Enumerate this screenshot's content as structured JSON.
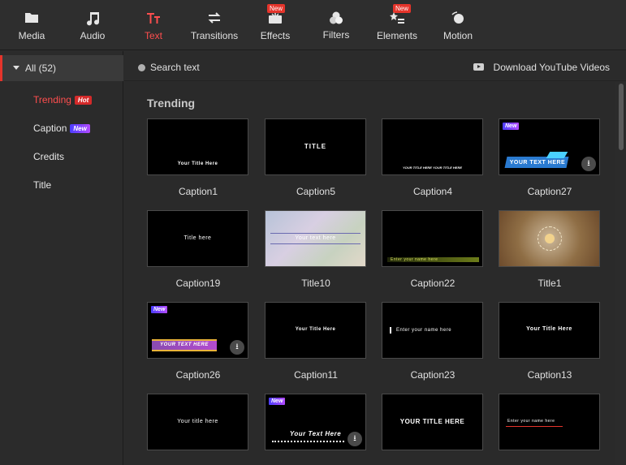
{
  "toolbar": {
    "tabs": [
      {
        "label": "Media",
        "icon": "folder-icon",
        "active": false,
        "new": false
      },
      {
        "label": "Audio",
        "icon": "music-note-icon",
        "active": false,
        "new": false
      },
      {
        "label": "Text",
        "icon": "text-icon",
        "active": true,
        "new": false
      },
      {
        "label": "Transitions",
        "icon": "transitions-icon",
        "active": false,
        "new": false
      },
      {
        "label": "Effects",
        "icon": "effects-icon",
        "active": false,
        "new": true
      },
      {
        "label": "Filters",
        "icon": "filters-icon",
        "active": false,
        "new": false
      },
      {
        "label": "Elements",
        "icon": "elements-icon",
        "active": false,
        "new": true
      },
      {
        "label": "Motion",
        "icon": "motion-icon",
        "active": false,
        "new": false
      }
    ],
    "new_badge": "New",
    "accent": "#ff4e4e"
  },
  "sidebar": {
    "all_label": "All (52)",
    "items": [
      {
        "label": "Trending",
        "tag": "Hot",
        "active": true
      },
      {
        "label": "Caption",
        "tag": "New",
        "active": false
      },
      {
        "label": "Credits",
        "tag": "",
        "active": false
      },
      {
        "label": "Title",
        "tag": "",
        "active": false
      }
    ]
  },
  "search": {
    "placeholder": "Search text",
    "download_label": "Download YouTube Videos"
  },
  "content": {
    "section_title": "Trending",
    "card_new_tag": "New",
    "cards": [
      {
        "name": "Caption1",
        "thumb_text": "Your  Title Here",
        "style": "caption1"
      },
      {
        "name": "Caption5",
        "thumb_text": "TITLE",
        "style": "caption5"
      },
      {
        "name": "Caption4",
        "thumb_text": "YOUR TITLE HERE YOUR TITLE HERE",
        "style": "caption4"
      },
      {
        "name": "Caption27",
        "thumb_text": "YOUR TEXT HERE",
        "style": "caption27"
      },
      {
        "name": "Caption19",
        "thumb_text": "Title here",
        "style": "caption19"
      },
      {
        "name": "Title10",
        "thumb_text": "Your text here",
        "style": "title10"
      },
      {
        "name": "Caption22",
        "thumb_text": "Enter your name here",
        "style": "caption22"
      },
      {
        "name": "Title1",
        "thumb_text": "",
        "style": "title1"
      },
      {
        "name": "Caption26",
        "thumb_text": "YOUR TEXT HERE",
        "style": "caption26"
      },
      {
        "name": "Caption11",
        "thumb_text": "Your  Title Here",
        "style": "caption11"
      },
      {
        "name": "Caption23",
        "thumb_text": "Enter your name here",
        "style": "caption23"
      },
      {
        "name": "Caption13",
        "thumb_text": "Your  Title Here",
        "style": "caption13"
      },
      {
        "name": "",
        "thumb_text": "Your title here",
        "style": "row4a"
      },
      {
        "name": "",
        "thumb_text": "Your Text Here",
        "style": "row4b"
      },
      {
        "name": "",
        "thumb_text": "YOUR TITLE HERE",
        "style": "row4c"
      },
      {
        "name": "",
        "thumb_text": "Enter your name here",
        "style": "row4d"
      }
    ]
  }
}
